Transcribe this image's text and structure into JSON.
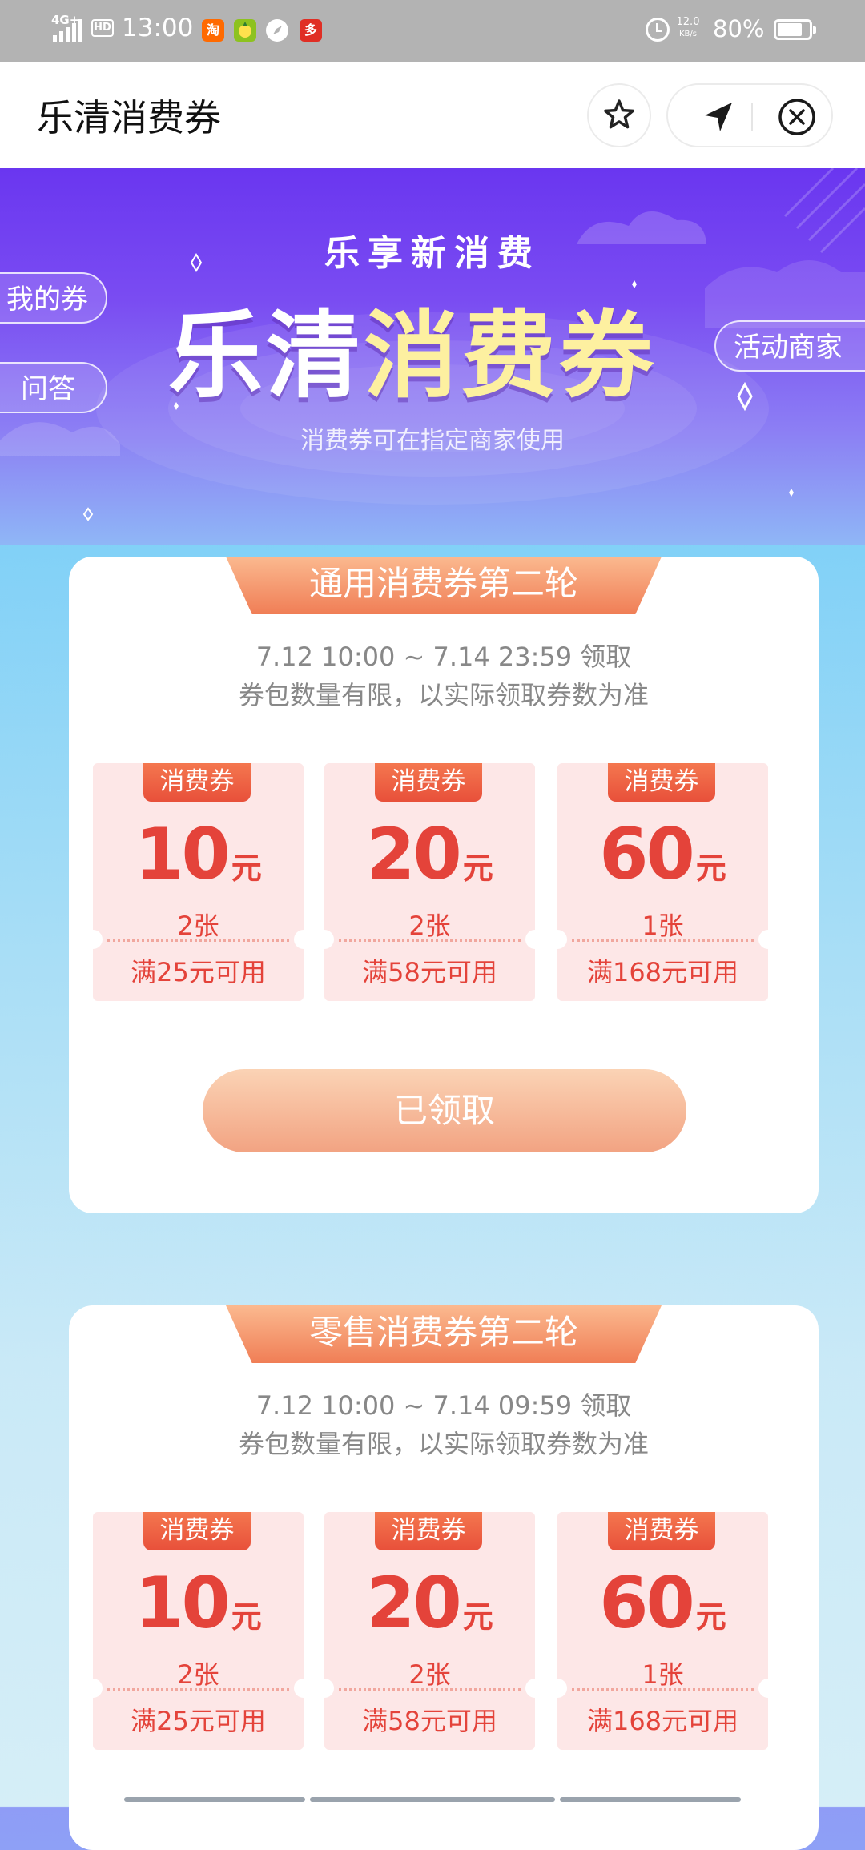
{
  "status_bar": {
    "network": "4G+",
    "hd_label": "HD",
    "time": "13:00",
    "app_icons": [
      {
        "name": "taobao-icon",
        "label": "淘",
        "color": "#ff6a00"
      },
      {
        "name": "fruit-app-icon",
        "label": "",
        "color": "#8dc21f"
      },
      {
        "name": "compass-app-icon",
        "label": "",
        "color": "#ffffff"
      },
      {
        "name": "pinduoduo-icon",
        "label": "多",
        "color": "#e02e24"
      }
    ],
    "net_speed": "12.0",
    "net_speed_unit": "KB/s",
    "battery": "80%",
    "battery_level": 0.8
  },
  "nav": {
    "title": "乐清消费券"
  },
  "hero": {
    "subtitle": "乐享新消费",
    "title_part1": "乐清",
    "title_part2": "消费券",
    "description": "消费券可在指定商家使用",
    "my_coupons": "我的券",
    "qa": "问答",
    "merchants": "活动商家"
  },
  "sections": [
    {
      "header": "通用消费券第二轮",
      "period": "7.12 10:00  ~  7.14 23:59 领取",
      "note": "券包数量有限，以实际领取券数为准",
      "coupons": [
        {
          "tag": "消费券",
          "amount": "10",
          "unit": "元",
          "qty": "2张",
          "condition": "满25元可用"
        },
        {
          "tag": "消费券",
          "amount": "20",
          "unit": "元",
          "qty": "2张",
          "condition": "满58元可用"
        },
        {
          "tag": "消费券",
          "amount": "60",
          "unit": "元",
          "qty": "1张",
          "condition": "满168元可用"
        }
      ],
      "button": "已领取"
    },
    {
      "header": "零售消费券第二轮",
      "period": "7.12 10:00  ~  7.14 09:59 领取",
      "note": "券包数量有限，以实际领取券数为准",
      "coupons": [
        {
          "tag": "消费券",
          "amount": "10",
          "unit": "元",
          "qty": "2张",
          "condition": "满25元可用"
        },
        {
          "tag": "消费券",
          "amount": "20",
          "unit": "元",
          "qty": "2张",
          "condition": "满58元可用"
        },
        {
          "tag": "消费券",
          "amount": "60",
          "unit": "元",
          "qty": "1张",
          "condition": "满168元可用"
        }
      ]
    }
  ],
  "colors": {
    "accent_red": "#e4433a",
    "coupon_bg": "#fde7e7",
    "hero_purple": "#6a36f0",
    "title_yellow": "#fdf0a0"
  }
}
